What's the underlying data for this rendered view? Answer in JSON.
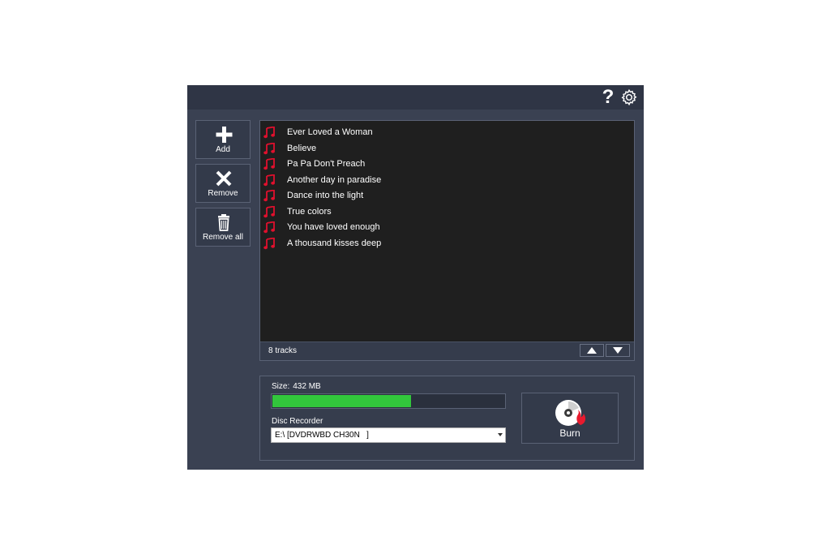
{
  "toolbar": {
    "help_icon": "question-mark",
    "settings_icon": "gear"
  },
  "sidebar": {
    "add_label": "Add",
    "remove_label": "Remove",
    "remove_all_label": "Remove all"
  },
  "tracklist": {
    "tracks": [
      {
        "name": "Ever Loved a Woman"
      },
      {
        "name": "Believe"
      },
      {
        "name": "Pa Pa Don't Preach"
      },
      {
        "name": "Another day in paradise"
      },
      {
        "name": "Dance into the light"
      },
      {
        "name": "True colors"
      },
      {
        "name": "You have loved enough"
      },
      {
        "name": "A thousand kisses deep"
      }
    ],
    "count_label": "8  tracks",
    "note_color": "#e0102d"
  },
  "burn": {
    "size_prefix": "Size:",
    "size_value": "432 MB",
    "progress_fraction": 0.6,
    "progress_color": "#32c63c",
    "recorder_label": "Disc Recorder",
    "recorder_value": "E:\\ [DVDRWBD CH30N   ]",
    "burn_label": "Burn"
  }
}
